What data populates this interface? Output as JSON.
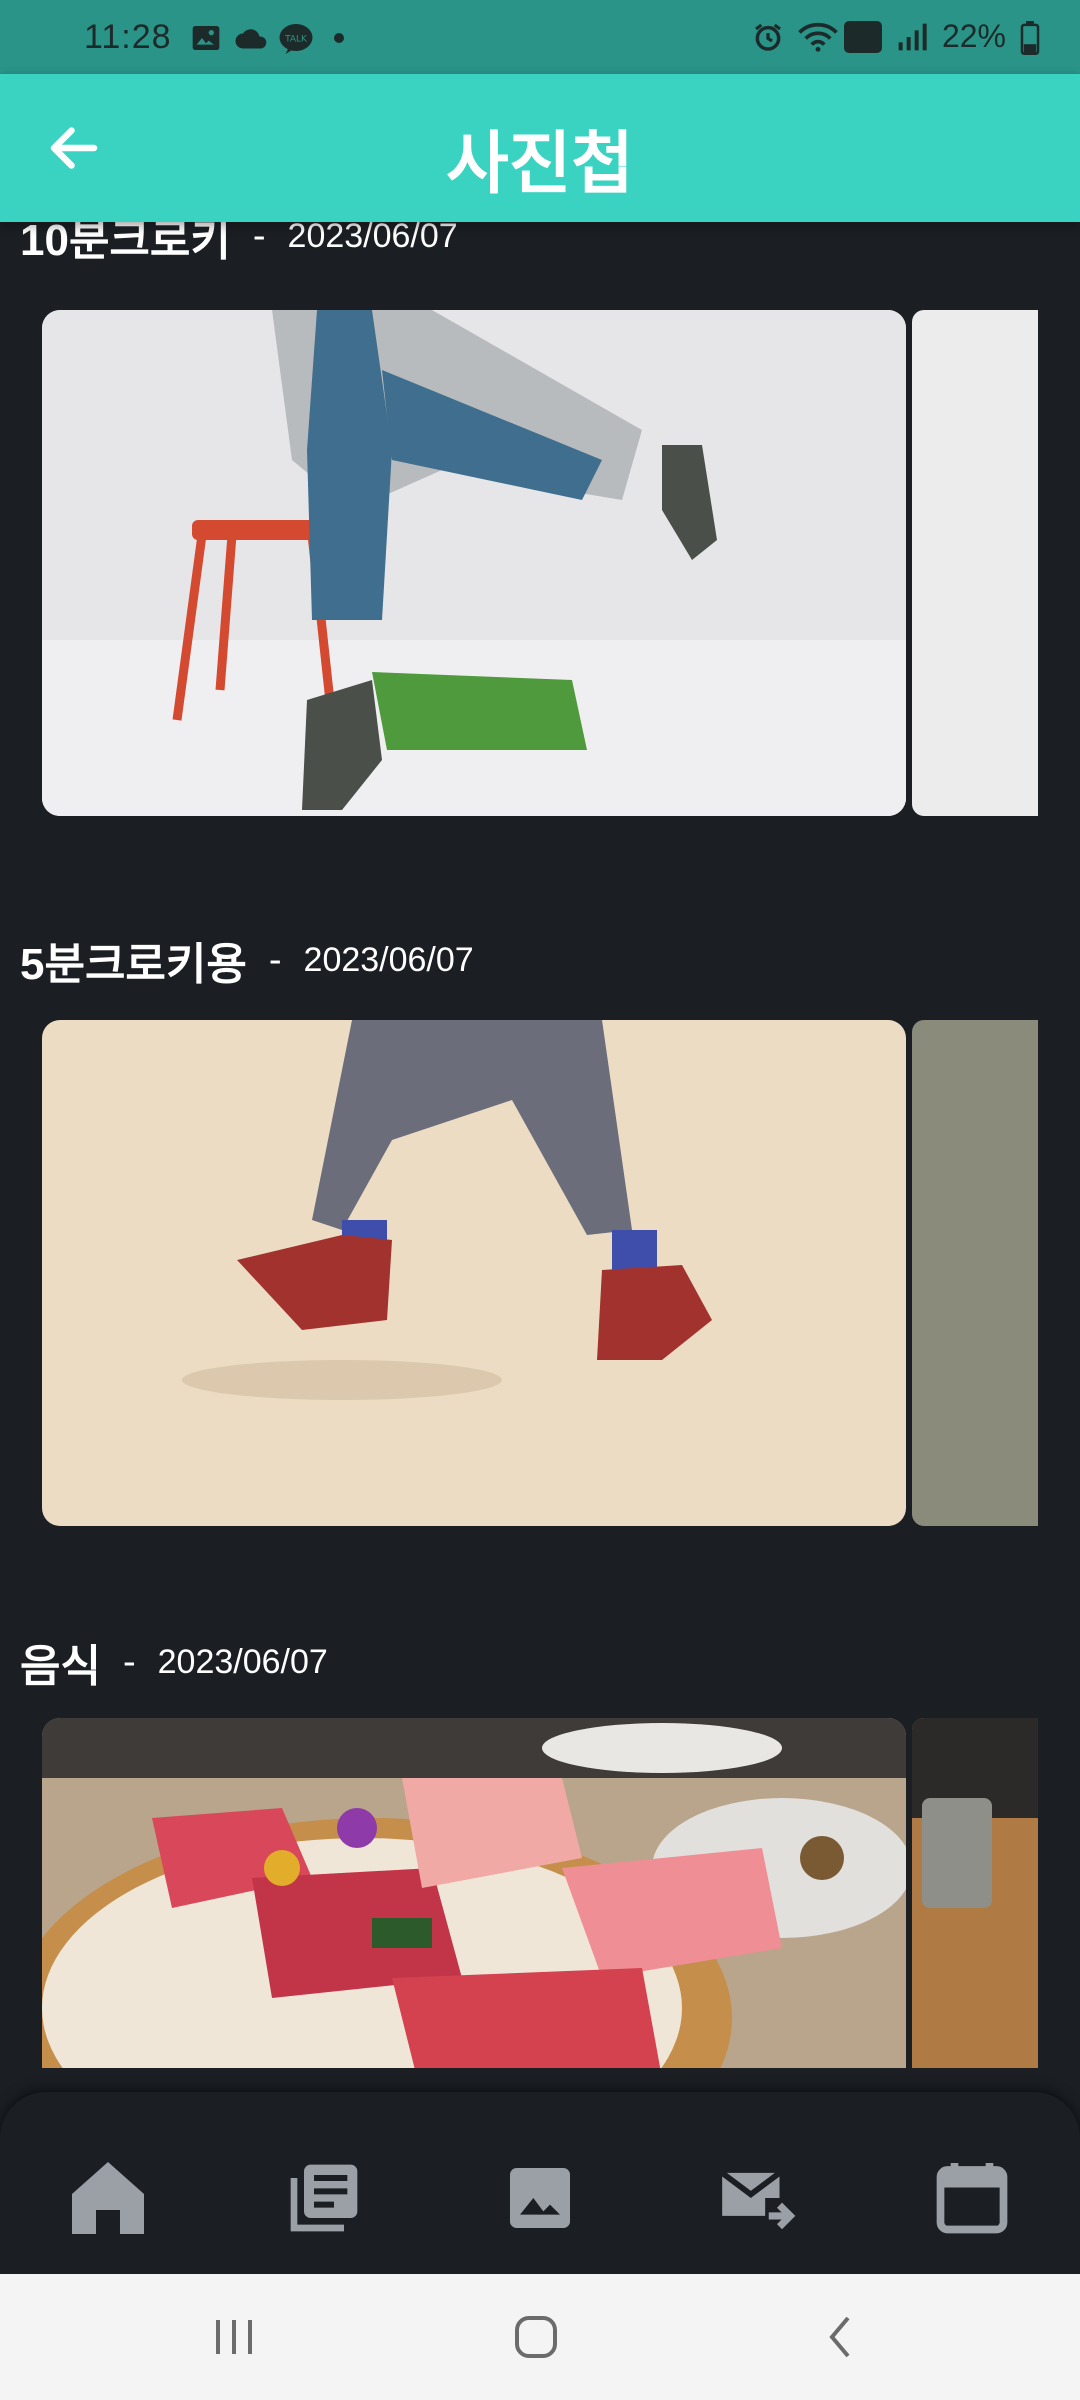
{
  "status_bar": {
    "time": "11:28",
    "battery": "22%",
    "left_icons": [
      "gallery-icon",
      "cloud-icon",
      "talk-icon",
      "dot-icon"
    ],
    "right_icons": [
      "alarm-icon",
      "wifi-icon",
      "hd-voice-icon",
      "signal-icon",
      "battery-icon"
    ]
  },
  "header": {
    "title": "사진첩",
    "back_icon": "arrow-left-icon",
    "background": "#3ad3c2"
  },
  "albums": [
    {
      "title": "10분크로키",
      "separator": "-",
      "date": "2023/06/07"
    },
    {
      "title": "5분크로키용",
      "separator": "-",
      "date": "2023/06/07"
    },
    {
      "title": "음식",
      "separator": "-",
      "date": "2023/06/07"
    }
  ],
  "bottom_nav": {
    "items": [
      "home-icon",
      "library-icon",
      "image-icon",
      "forward-mail-icon",
      "calendar-icon"
    ],
    "active": "home-icon"
  },
  "system_nav": [
    "recents-icon",
    "home-circle-icon",
    "back-chevron-icon"
  ],
  "colors": {
    "status_bar": "#2a9488",
    "accent": "#3ad3c2",
    "background": "#1b1f24",
    "icon": "#9aa0a6"
  }
}
